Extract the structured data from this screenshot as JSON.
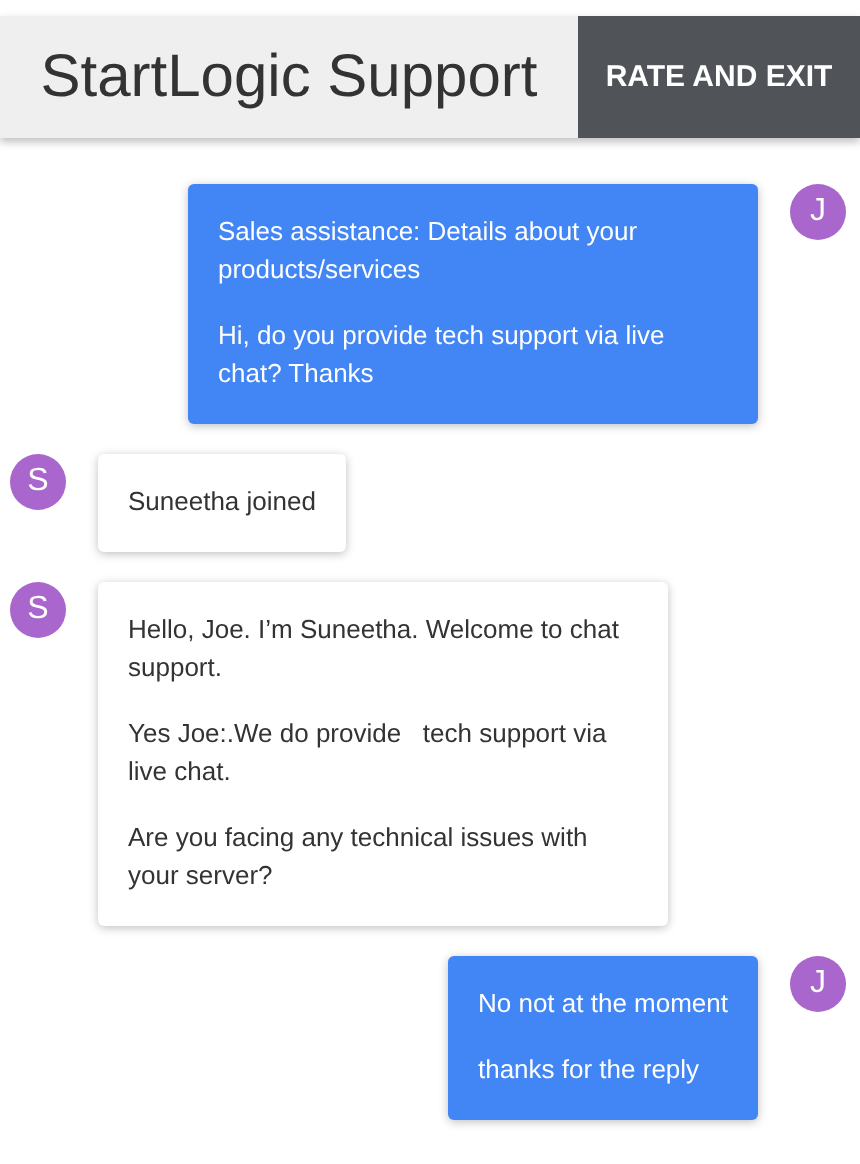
{
  "header": {
    "title": "StartLogic Support",
    "action": "RATE AND EXIT"
  },
  "messages": [
    {
      "kind": "outgoing",
      "avatar": "J",
      "paragraphs": [
        "Sales assistance: Details about your products/services",
        "Hi, do you provide tech support via live chat? Thanks"
      ]
    },
    {
      "kind": "incoming",
      "avatar": "S",
      "paragraphs": [
        "Suneetha joined"
      ]
    },
    {
      "kind": "incoming",
      "avatar": "S",
      "paragraphs": [
        "Hello, Joe. I’m Suneetha. Welcome to chat support.",
        "Yes Joe:.We do provide   tech support via live chat.",
        "Are you facing any technical issues with your server?"
      ]
    },
    {
      "kind": "outgoing",
      "avatar": "J",
      "paragraphs": [
        "No not at the moment",
        "thanks for the reply"
      ]
    }
  ]
}
